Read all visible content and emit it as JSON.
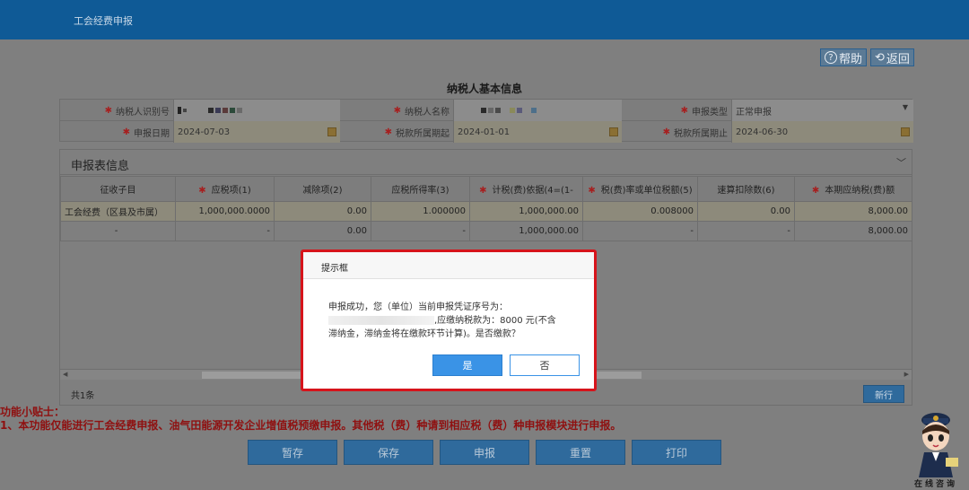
{
  "app": {
    "title": "工会经费申报"
  },
  "toolbar": {
    "help_label": "帮助",
    "back_label": "返回"
  },
  "basic_info": {
    "title": "纳税人基本信息",
    "taxpayer_id_label": "纳税人识别号",
    "taxpayer_name_label": "纳税人名称",
    "report_type_label": "申报类型",
    "report_type_value": "正常申报",
    "report_date_label": "申报日期",
    "report_date_value": "2024-07-03",
    "period_start_label": "税款所属期起",
    "period_start_value": "2024-01-01",
    "period_end_label": "税款所属期止",
    "period_end_value": "2024-06-30"
  },
  "table_section": {
    "title": "申报表信息",
    "headers": [
      "征收子目",
      "应税项(1)",
      "减除项(2)",
      "应税所得率(3)",
      "计税(费)依据(4=(1-",
      "税(费)率或单位税额(5)",
      "速算扣除数(6)",
      "本期应纳税(费)额"
    ],
    "rows": [
      [
        "工会经费（区县及市属）",
        "1,000,000.0000",
        "0.00",
        "1.000000",
        "1,000,000.00",
        "0.008000",
        "0.00",
        "8,000.00"
      ],
      [
        "-",
        "-",
        "0.00",
        "-",
        "1,000,000.00",
        "-",
        "-",
        "8,000.00"
      ]
    ],
    "count_label": "共1条",
    "new_row_label": "新行"
  },
  "tips": {
    "title": "功能小贴士：",
    "line": "1、本功能仅能进行工会经费申报、油气田能源开发企业增值税预缴申报。其他税（费）种请到相应税（费）种申报模块进行申报。"
  },
  "actions": [
    "暂存",
    "保存",
    "申报",
    "重置",
    "打印"
  ],
  "mascot": {
    "label": "在线咨询"
  },
  "modal": {
    "title": "提示框",
    "line1": "申报成功，您（单位）当前申报凭证序号为：",
    "line2": ",应缴纳税款为：8000 元(不含",
    "line3": "滞纳金，滞纳金将在缴款环节计算)。是否缴款？",
    "yes_label": "是",
    "no_label": "否"
  },
  "colors": {
    "accent": "#0f5a96",
    "modal_border": "#d6141b",
    "primary_button": "#3a93e6",
    "tip_text": "#8f1010"
  }
}
